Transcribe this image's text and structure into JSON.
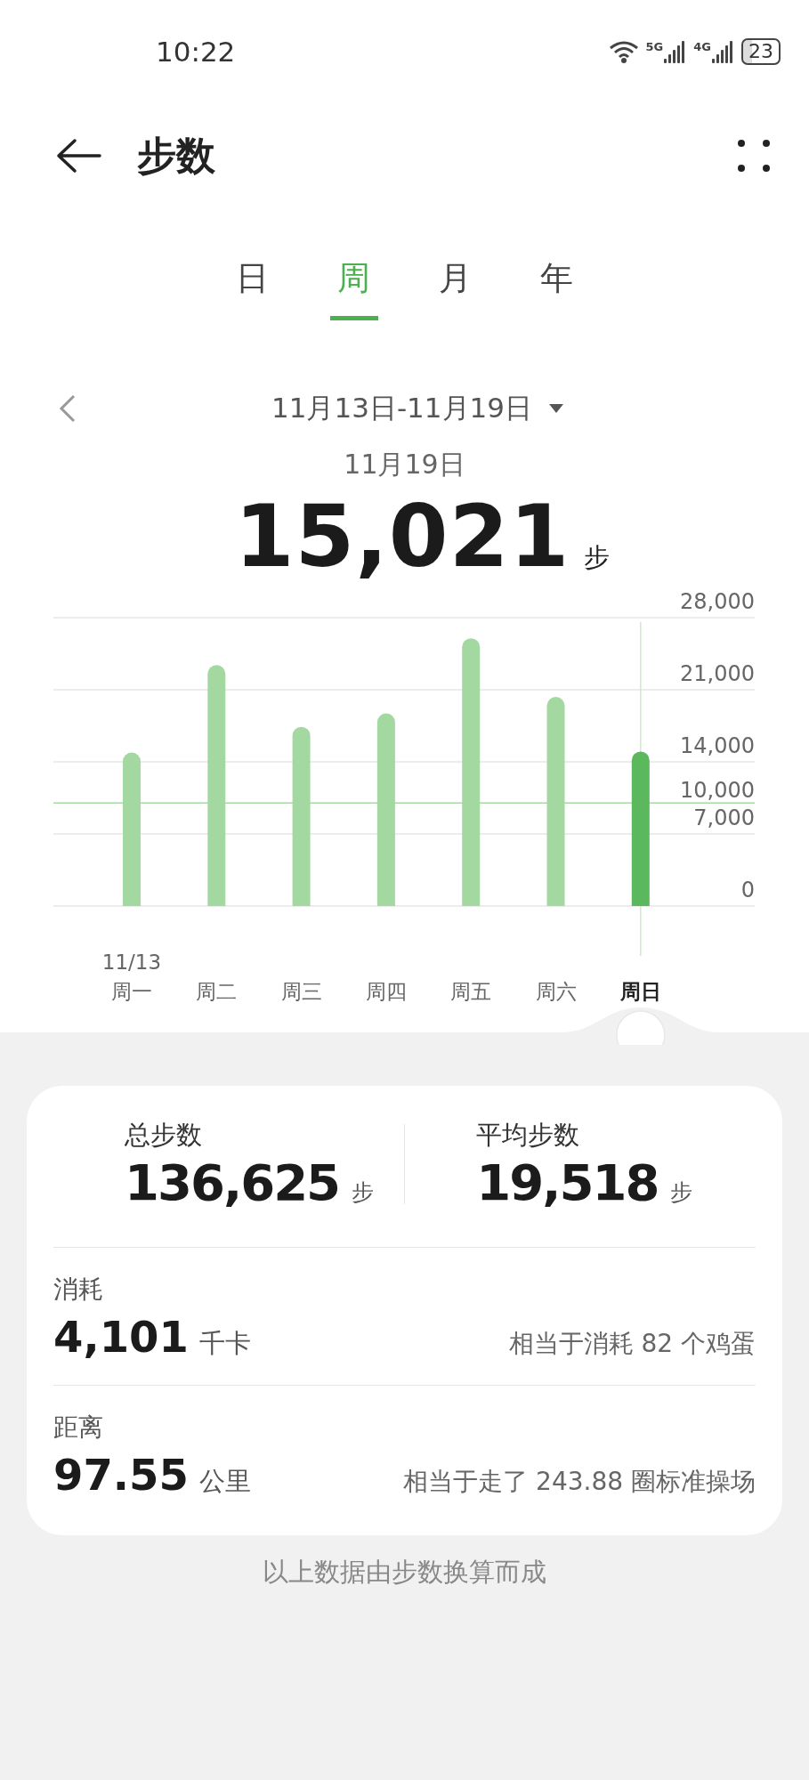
{
  "status_bar": {
    "time": "10:22",
    "battery": "23",
    "network_labels": [
      "5G",
      "4G"
    ]
  },
  "header": {
    "title": "步数"
  },
  "tabs": [
    {
      "label": "日",
      "selected": false
    },
    {
      "label": "周",
      "selected": true
    },
    {
      "label": "月",
      "selected": false
    },
    {
      "label": "年",
      "selected": false
    }
  ],
  "range": {
    "label": "11月13日-11月19日"
  },
  "day_detail": {
    "date": "11月19日",
    "value": "15,021",
    "unit": "步"
  },
  "chart": {
    "first_date": "11/13",
    "chart_data": {
      "type": "bar",
      "categories": [
        "周一",
        "周二",
        "周三",
        "周四",
        "周五",
        "周六",
        "周日"
      ],
      "grid": true,
      "series": [
        {
          "color": "#a3d9a0",
          "values": [
            14900,
            23400,
            17400,
            18700,
            26000,
            20300,
            null
          ]
        },
        {
          "color": "#5cb85c",
          "values": [
            null,
            null,
            null,
            null,
            null,
            null,
            15000
          ]
        }
      ],
      "ylim": [
        0,
        28000
      ],
      "yticks": [
        {
          "value": 0,
          "label": "0"
        },
        {
          "value": 7000,
          "label": "7,000"
        },
        {
          "value": 14000,
          "label": "14,000"
        },
        {
          "value": 21000,
          "label": "21,000"
        },
        {
          "value": 28000,
          "label": "28,000"
        }
      ],
      "ref_lines": [
        {
          "axis": "y",
          "value": 10000,
          "label": "10,000",
          "color": "#a8d8a4"
        }
      ]
    }
  },
  "summary": {
    "items": [
      {
        "label": "总步数",
        "value": "136,625",
        "unit": "步"
      },
      {
        "label": "平均步数",
        "value": "19,518",
        "unit": "步"
      }
    ]
  },
  "metrics": [
    {
      "label": "消耗",
      "value": "4,101",
      "unit": "千卡",
      "note": "相当于消耗 82 个鸡蛋"
    },
    {
      "label": "距离",
      "value": "97.55",
      "unit": "公里",
      "note": "相当于走了 243.88 圈标准操场"
    }
  ],
  "footnote": "以上数据由步数换算而成"
}
